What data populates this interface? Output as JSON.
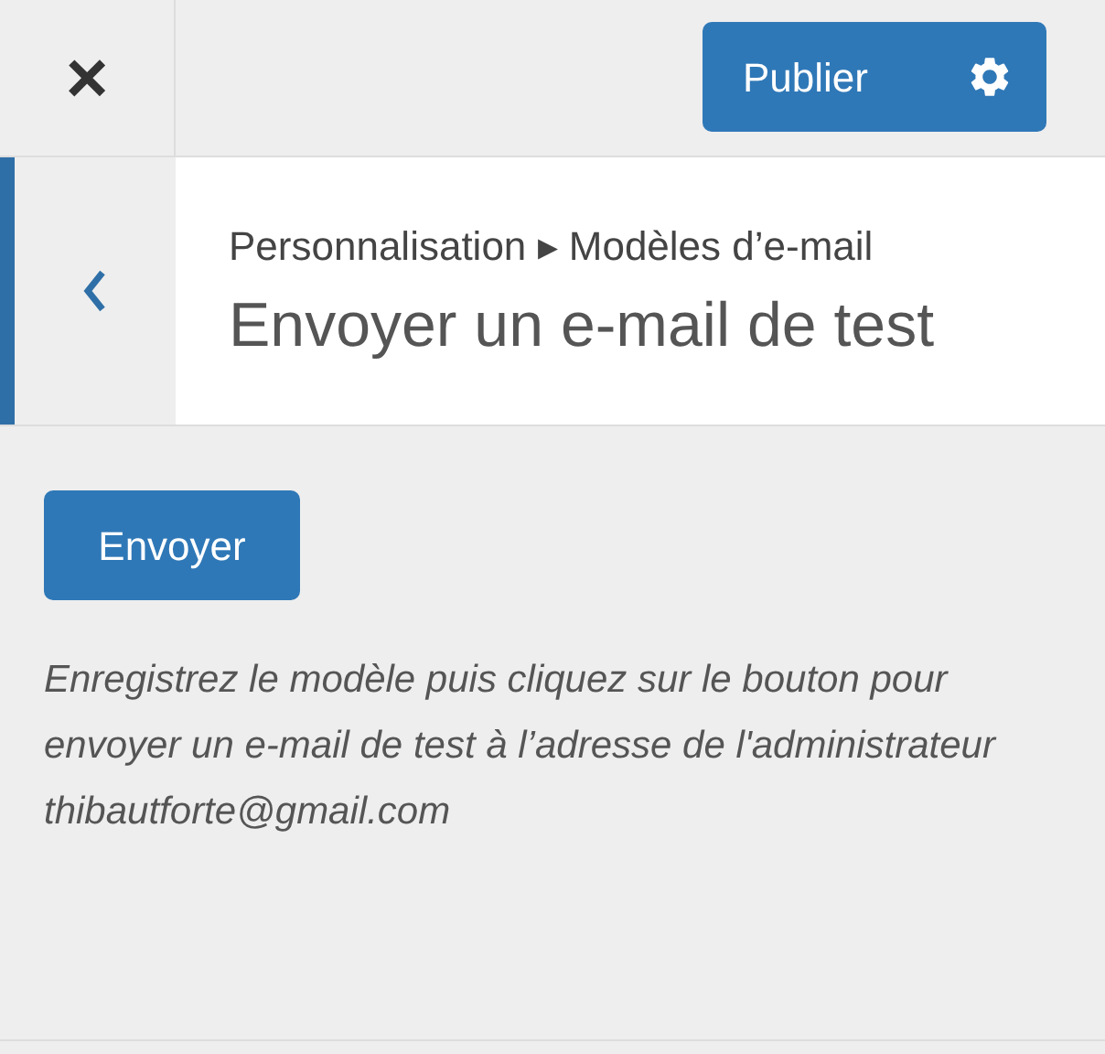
{
  "header": {
    "close": "×",
    "publish_button": "Publier"
  },
  "section": {
    "breadcrumb": "Personnalisation ▸ Modèles d’e-mail",
    "title": "Envoyer un e-mail de test"
  },
  "send_button": "Envoyer",
  "description": "Enregistrez le modèle puis cliquez sur le bouton pour envoyer un e-mail de test à l’adresse de l'administrateur thibautforte@gmail.com"
}
